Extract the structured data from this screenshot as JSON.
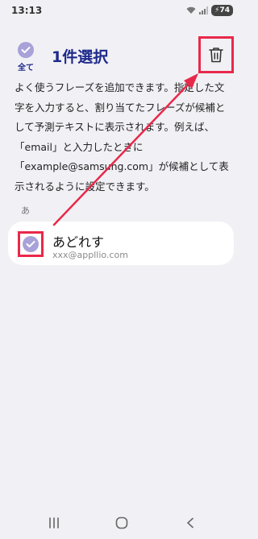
{
  "status_bar": {
    "time": "13:13",
    "battery": "74",
    "icons": [
      "wifi-icon",
      "signal-icon",
      "battery-icon"
    ]
  },
  "header": {
    "select_all_label": "全て",
    "title": "1件選択",
    "delete_icon": "trash-icon"
  },
  "description": "よく使うフレーズを追加できます。指定した文字を入力すると、割り当てたフレーズが候補として予測テキストに表示されます。例えば、「email」と入力したときに「example@samsung.com」が候補として表示されるように設定できます。",
  "section": {
    "header": "あ"
  },
  "phrases": [
    {
      "phrase": "あどれす",
      "text": "xxx@appllio.com",
      "checked": true
    }
  ],
  "colors": {
    "accent": "#1e2a8a",
    "check": "#a8a2d8",
    "highlight": "#e8294a",
    "background": "#f1f0f5"
  },
  "nav": [
    "recent-apps-icon",
    "home-icon",
    "back-icon"
  ]
}
